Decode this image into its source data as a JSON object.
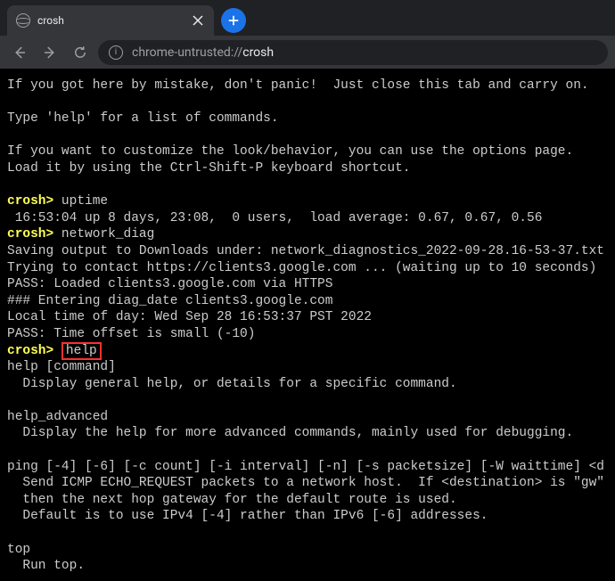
{
  "tab": {
    "title": "crosh"
  },
  "url": {
    "scheme": "chrome-untrusted://",
    "path": "crosh"
  },
  "term": {
    "intro1": "If you got here by mistake, don't panic!  Just close this tab and carry on.",
    "intro2": "Type 'help' for a list of commands.",
    "intro3": "If you want to customize the look/behavior, you can use the options page.",
    "intro4": "Load it by using the Ctrl-Shift-P keyboard shortcut.",
    "prompt": "crosh>",
    "cmd_uptime": " uptime",
    "uptime_out": " 16:53:04 up 8 days, 23:08,  0 users,  load average: 0.67, 0.67, 0.56",
    "cmd_netdiag": " network_diag",
    "nd1": "Saving output to Downloads under: network_diagnostics_2022-09-28.16-53-37.txt",
    "nd2": "Trying to contact https://clients3.google.com ... (waiting up to 10 seconds)",
    "nd3": "PASS: Loaded clients3.google.com via HTTPS",
    "nd4": "### Entering diag_date clients3.google.com",
    "nd5": "Local time of day: Wed Sep 28 16:53:37 PST 2022",
    "nd6": "PASS: Time offset is small (-10)",
    "cmd_help_pre": " ",
    "cmd_help": "help",
    "h1": "help [command]",
    "h2": "  Display general help, or details for a specific command.",
    "h3": "help_advanced",
    "h4": "  Display the help for more advanced commands, mainly used for debugging.",
    "h5": "ping [-4] [-6] [-c count] [-i interval] [-n] [-s packetsize] [-W waittime] <d",
    "h6": "  Send ICMP ECHO_REQUEST packets to a network host.  If <destination> is \"gw\"",
    "h7": "  then the next hop gateway for the default route is used.",
    "h8": "  Default is to use IPv4 [-4] rather than IPv6 [-6] addresses.",
    "h9": "top",
    "h10": "  Run top."
  }
}
